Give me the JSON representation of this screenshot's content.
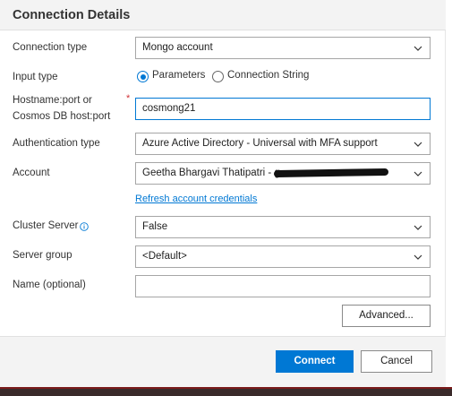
{
  "dialog": {
    "title": "Connection Details"
  },
  "form": {
    "connection_type": {
      "label": "Connection type",
      "value": "Mongo account"
    },
    "input_type": {
      "label": "Input type",
      "options": [
        {
          "label": "Parameters",
          "selected": true
        },
        {
          "label": "Connection String",
          "selected": false
        }
      ]
    },
    "hostname": {
      "label_line1": "Hostname:port or",
      "label_line2": "Cosmos DB host:port",
      "required_marker": "*",
      "value": "cosmong21"
    },
    "authentication_type": {
      "label": "Authentication type",
      "value": "Azure Active Directory - Universal with MFA support"
    },
    "account": {
      "label": "Account",
      "value": "Geetha Bhargavi Thatipatri - g"
    },
    "refresh_link": "Refresh account credentials",
    "cluster_server": {
      "label": "Cluster Server",
      "value": "False"
    },
    "server_group": {
      "label": "Server group",
      "value": "<Default>"
    },
    "name": {
      "label": "Name (optional)",
      "value": ""
    }
  },
  "buttons": {
    "advanced": "Advanced...",
    "connect": "Connect",
    "cancel": "Cancel"
  },
  "colors": {
    "accent": "#0078d4",
    "required": "#d13438"
  }
}
